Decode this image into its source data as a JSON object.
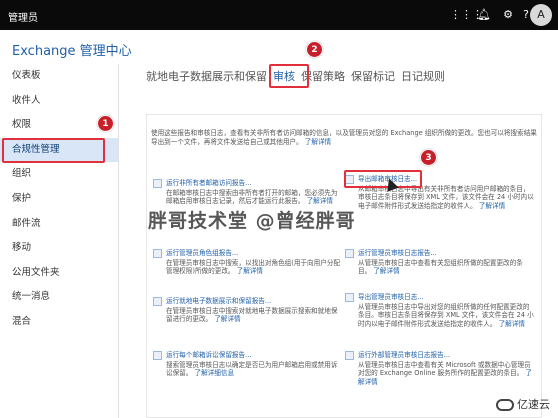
{
  "topbar": {
    "brand": "管理员",
    "avatar_letter": "A",
    "icons": [
      "grid-icon",
      "bell-icon",
      "gear-icon",
      "help-icon"
    ]
  },
  "app_title": "Exchange 管理中心",
  "sidebar": {
    "items": [
      {
        "label": "仪表板"
      },
      {
        "label": "收件人"
      },
      {
        "label": "权限"
      },
      {
        "label": "合规性管理"
      },
      {
        "label": "组织"
      },
      {
        "label": "保护"
      },
      {
        "label": "邮件流"
      },
      {
        "label": "移动"
      },
      {
        "label": "公用文件夹"
      },
      {
        "label": "统一消息"
      },
      {
        "label": "混合"
      }
    ],
    "active_index": 3
  },
  "tabs": [
    {
      "label": "就地电子数据展示和保留"
    },
    {
      "label": "审核"
    },
    {
      "label": "保留策略"
    },
    {
      "label": "保留标记"
    },
    {
      "label": "日记规则"
    }
  ],
  "intro": {
    "text": "使用这些报告和审核日志，查看有关非所有者访问邮箱的信息，以及管理员对您的 Exchange 组织所做的更改。您也可以将搜索结果导出到一个文件，再将文件发送给自己或其他用户。",
    "link": "了解详情"
  },
  "cards": [
    {
      "title": "运行非所有者邮箱访问报告...",
      "desc": "在邮箱审核日志中搜索由非所有者打开的邮箱，您必须先为邮箱启用审核日志记录，然后才能运行此报告。",
      "more": "了解详情"
    },
    {
      "title": "导出邮箱审核日志...",
      "desc": "从邮箱审核日志中导出有关非所有者访问用户邮箱的条目，审核日志条目将保存到 XML 文件，该文件会在 24 小时内以电子邮件附件形式发送给指定的收件人。",
      "more": "了解详情"
    },
    {
      "title": "运行管理员角色组报告...",
      "desc": "在管理员审核日志中搜索，以找出对角色组(用于向用户分配管理权限)所做的更改。",
      "more": "了解详情"
    },
    {
      "title": "运行管理员审核日志报告...",
      "desc": "从管理员审核日志中查看有关您组织所做的配置更改的条目。",
      "more": "了解详情"
    },
    {
      "title": "运行就地电子数据展示和保留报告...",
      "desc": "在管理员审核日志中搜索对就地电子数据展示搜索和就地保留进行的更改。",
      "more": "了解详情"
    },
    {
      "title": "导出管理员审核日志...",
      "desc": "从管理员审核日志中导出对您的组织所做的任何配置更改的条目。审核日志条目将保存到 XML 文件，该文件会在 24 小时内以电子邮件附件形式发送给指定的收件人。",
      "more": "了解详情"
    },
    {
      "title": "运行每个邮箱诉讼保留报告...",
      "desc": "搜索管理员审核日志以确定是否已为用户邮箱启用或禁用诉讼保留。",
      "more": "了解详细信息"
    },
    {
      "title": "运行外部管理员审核日志报告...",
      "desc": "从管理员审核日志中查看有关 Microsoft 或数据中心管理员对您的 Exchange Online 服务所作的配置更改的条目。",
      "more": "了解详情"
    }
  ],
  "badges": [
    "1",
    "2",
    "3"
  ],
  "watermark": "胖哥技术堂 @曾经胖哥",
  "corner_logo": "亿速云",
  "colors": {
    "topbar": "#0a0a0a",
    "accent": "#1f5fa8",
    "highlight": "#e0303b",
    "active_bg": "#d8e6f7"
  }
}
